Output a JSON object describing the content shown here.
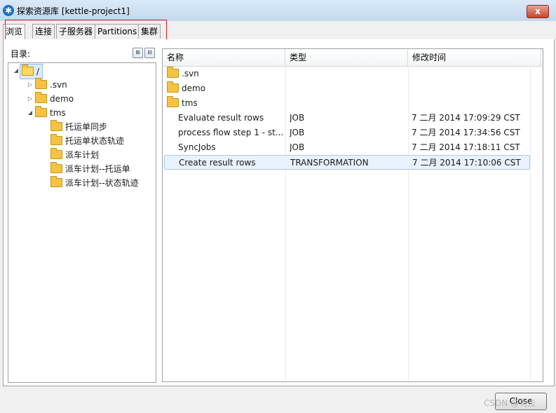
{
  "window": {
    "title": "探索资源库 [kettle-project1]",
    "close_glyph": "x"
  },
  "tabs": [
    {
      "label": "浏览",
      "active": true
    },
    {
      "label": "连接",
      "active": false
    },
    {
      "label": "子服务器",
      "active": false
    },
    {
      "label": "Partitions",
      "active": false
    },
    {
      "label": "集群",
      "active": false
    }
  ],
  "left_panel": {
    "label": "目录:",
    "tree": [
      {
        "label": "/",
        "arrow": "◢",
        "icon": "folder-open-icon"
      },
      {
        "label": ".svn",
        "arrow": "▷",
        "icon": "folder-icon"
      },
      {
        "label": "demo",
        "arrow": "▷",
        "icon": "folder-icon"
      },
      {
        "label": "tms",
        "arrow": "◢",
        "icon": "folder-icon"
      },
      {
        "label": "托运单同步",
        "arrow": "",
        "icon": "folder-icon"
      },
      {
        "label": "托运单状态轨迹",
        "arrow": "",
        "icon": "folder-icon"
      },
      {
        "label": "派车计划",
        "arrow": "",
        "icon": "folder-icon"
      },
      {
        "label": "派车计划--托运单",
        "arrow": "",
        "icon": "folder-icon"
      },
      {
        "label": "派车计划--状态轨迹",
        "arrow": "",
        "icon": "folder-icon"
      }
    ]
  },
  "table": {
    "headers": [
      "名称",
      "类型",
      "修改时间"
    ],
    "rows": [
      {
        "name": ".svn",
        "type": "",
        "modified": "",
        "icon": "folder-icon"
      },
      {
        "name": "demo",
        "type": "",
        "modified": "",
        "icon": "folder-icon"
      },
      {
        "name": "tms",
        "type": "",
        "modified": "",
        "icon": "folder-icon"
      },
      {
        "name": "Evaluate result rows",
        "type": "JOB",
        "modified": "7 二月 2014 17:09:29 CST",
        "icon": ""
      },
      {
        "name": "process flow step 1 - st...",
        "type": "JOB",
        "modified": "7 二月 2014 17:34:56 CST",
        "icon": ""
      },
      {
        "name": "SyncJobs",
        "type": "JOB",
        "modified": "7 二月 2014 17:18:11 CST",
        "icon": ""
      },
      {
        "name": "Create result rows",
        "type": "TRANSFORMATION",
        "modified": "7 二月 2014 17:10:06 CST",
        "icon": "",
        "selected": true
      }
    ]
  },
  "footer": {
    "close_label": "Close",
    "watermark": "CSDN @乌去"
  },
  "colors": {
    "highlight_box": "#e01b1b",
    "selection": "#e8f1fc",
    "folder": "#f5c242"
  }
}
